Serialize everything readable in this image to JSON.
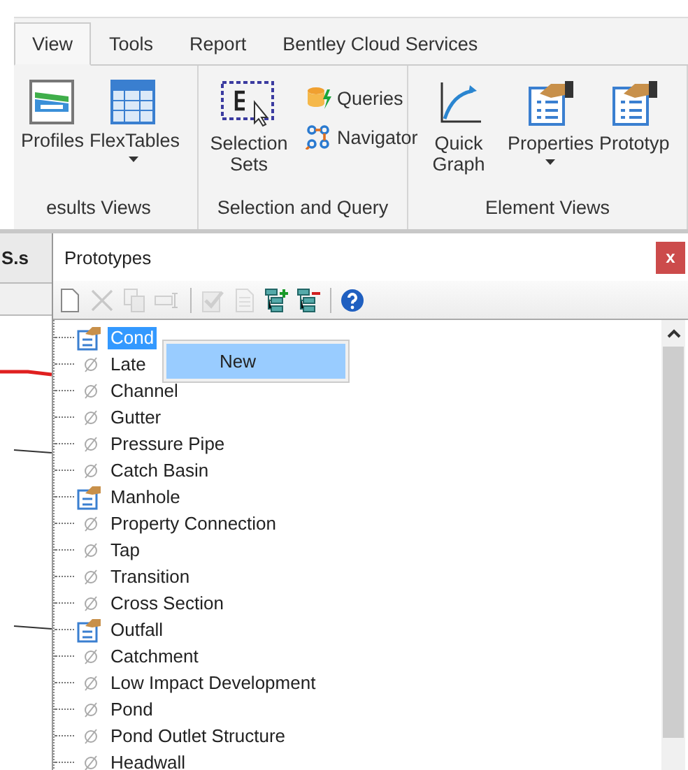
{
  "ribbon": {
    "tabs": [
      {
        "label": "View",
        "selected": true
      },
      {
        "label": "Tools",
        "selected": false
      },
      {
        "label": "Report",
        "selected": false
      },
      {
        "label": "Bentley Cloud Services",
        "selected": false
      }
    ],
    "groups": [
      {
        "label": "esults Views",
        "commands": [
          {
            "kind": "profiles",
            "label": "Profiles",
            "dropdown": false
          },
          {
            "kind": "flextables",
            "label": "FlexTables",
            "dropdown": true
          }
        ]
      },
      {
        "label": "Selection and Query",
        "commands": [
          {
            "kind": "selection",
            "label": "Selection Sets",
            "dropdown": false
          },
          {
            "kind": "queries",
            "label": "Queries"
          },
          {
            "kind": "navigator",
            "label": "Navigator"
          }
        ]
      },
      {
        "label": "Element Views",
        "commands": [
          {
            "kind": "graph",
            "label": "Quick Graph",
            "dropdown": false
          },
          {
            "kind": "properties",
            "label": "Properties",
            "dropdown": true
          },
          {
            "kind": "prototypes",
            "label": "Prototyp",
            "dropdown": false
          }
        ]
      }
    ]
  },
  "document": {
    "tab": "S.s"
  },
  "panel": {
    "title": "Prototypes",
    "close": "x",
    "toolbar": [
      {
        "kind": "new",
        "disabled": false
      },
      {
        "kind": "delete",
        "disabled": true
      },
      {
        "kind": "copy",
        "disabled": true
      },
      {
        "kind": "rename",
        "disabled": true
      },
      {
        "kind": "separator"
      },
      {
        "kind": "default",
        "disabled": true
      },
      {
        "kind": "report",
        "disabled": true
      },
      {
        "kind": "expand",
        "disabled": false
      },
      {
        "kind": "collapse",
        "disabled": false
      },
      {
        "kind": "separator"
      },
      {
        "kind": "help",
        "disabled": false
      }
    ],
    "tree": [
      {
        "label": "Cond",
        "kind": "group",
        "selected": true
      },
      {
        "label": "Late",
        "kind": "empty",
        "selected": false
      },
      {
        "label": "Channel",
        "kind": "empty",
        "selected": false
      },
      {
        "label": "Gutter",
        "kind": "empty",
        "selected": false
      },
      {
        "label": "Pressure Pipe",
        "kind": "empty",
        "selected": false
      },
      {
        "label": "Catch Basin",
        "kind": "empty",
        "selected": false
      },
      {
        "label": "Manhole",
        "kind": "group",
        "selected": false
      },
      {
        "label": "Property Connection",
        "kind": "empty",
        "selected": false
      },
      {
        "label": "Tap",
        "kind": "empty",
        "selected": false
      },
      {
        "label": "Transition",
        "kind": "empty",
        "selected": false
      },
      {
        "label": "Cross Section",
        "kind": "empty",
        "selected": false
      },
      {
        "label": "Outfall",
        "kind": "group",
        "selected": false
      },
      {
        "label": "Catchment",
        "kind": "empty",
        "selected": false
      },
      {
        "label": "Low Impact Development",
        "kind": "empty",
        "selected": false
      },
      {
        "label": "Pond",
        "kind": "empty",
        "selected": false
      },
      {
        "label": "Pond Outlet Structure",
        "kind": "empty",
        "selected": false
      },
      {
        "label": "Headwall",
        "kind": "empty",
        "selected": false
      }
    ],
    "context_menu": {
      "items": [
        {
          "label": "New",
          "selected": true
        }
      ]
    }
  }
}
